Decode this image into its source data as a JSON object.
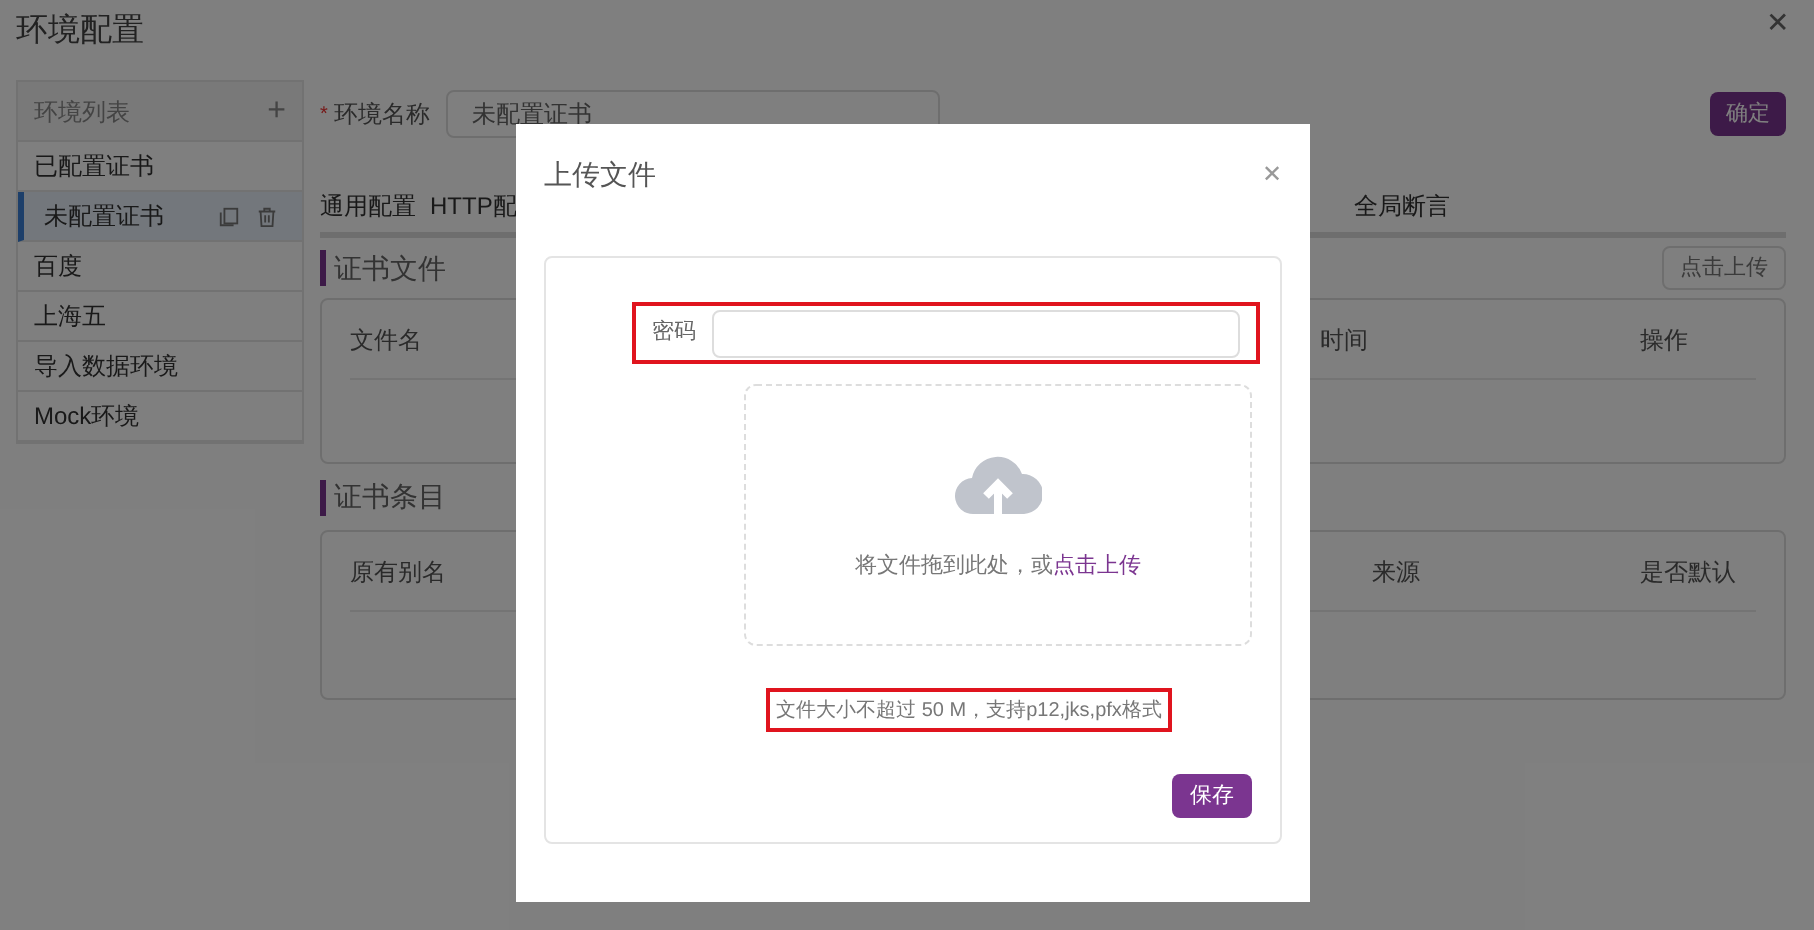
{
  "page": {
    "title": "环境配置",
    "close": "✕"
  },
  "sidebar": {
    "title": "环境列表",
    "add": "+",
    "items": [
      {
        "label": "已配置证书",
        "selected": false
      },
      {
        "label": "未配置证书",
        "selected": true
      },
      {
        "label": "百度",
        "selected": false
      },
      {
        "label": "上海五",
        "selected": false
      },
      {
        "label": "导入数据环境",
        "selected": false
      },
      {
        "label": "Mock环境",
        "selected": false
      }
    ]
  },
  "form": {
    "required_mark": "*",
    "label": "环境名称",
    "value": "未配置证书"
  },
  "confirm_button": "确定",
  "tabs": [
    {
      "label": "通用配置"
    },
    {
      "label": "HTTP配"
    },
    {
      "label": "全局断言"
    }
  ],
  "cert_files": {
    "title": "证书文件",
    "upload_button": "点击上传",
    "columns": [
      "文件名",
      "时间",
      "操作"
    ]
  },
  "cert_entries": {
    "title": "证书条目",
    "columns": [
      "原有别名",
      "来源",
      "是否默认"
    ]
  },
  "dialog": {
    "title": "上传文件",
    "close": "✕",
    "password_label": "密码",
    "drop_text": "将文件拖到此处，或",
    "drop_link": "点击上传",
    "hint": "文件大小不超过 50 M，支持p12,jks,pfx格式",
    "save_button": "保存"
  }
}
